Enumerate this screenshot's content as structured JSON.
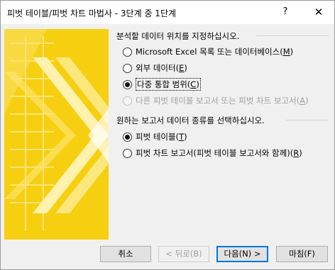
{
  "window": {
    "title": "피벗 테이블/피벗 차트 마법사 - 3단계 중 1단계",
    "help_label": "?",
    "close_label": "✕"
  },
  "data_source": {
    "label": "분석할 데이터 위치를 지정하십시오.",
    "options": [
      {
        "text": "Microsoft Excel 목록 또는 데이터베이스",
        "key": "M",
        "checked": false,
        "disabled": false
      },
      {
        "text": "외부 데이터",
        "key": "E",
        "checked": false,
        "disabled": false
      },
      {
        "text": "다중 통합 범위",
        "key": "C",
        "checked": true,
        "disabled": false
      },
      {
        "text": "다른 피벗 테이블 보고서 또는 피벗 차트 보고서",
        "key": "A",
        "checked": false,
        "disabled": true
      }
    ]
  },
  "report_type": {
    "label": "원하는 보고서 데이터 종류를 선택하십시오.",
    "options": [
      {
        "text": "피벗 테이블",
        "key": "T",
        "checked": true,
        "disabled": false
      },
      {
        "text": "피벗 차트 보고서(피벗 테이블 보고서와 함께)",
        "key": "R",
        "checked": false,
        "disabled": false
      }
    ]
  },
  "buttons": {
    "cancel": "취소",
    "back": "< 뒤로(B)",
    "next": "다음(N) >",
    "finish": "마침(F)"
  },
  "colors": {
    "art_yellow": "#f5cc00",
    "art_light": "#fde98a",
    "default_button_border": "#0078d7"
  }
}
